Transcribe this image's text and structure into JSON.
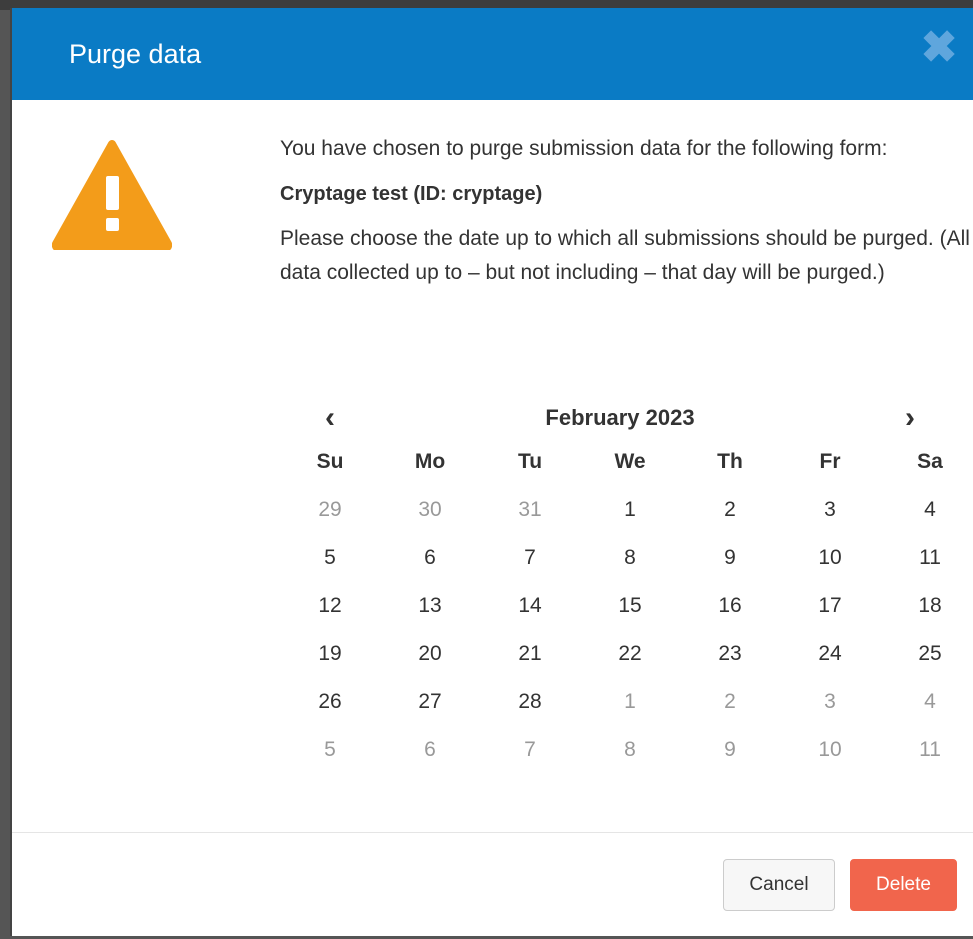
{
  "dialog": {
    "title": "Purge data",
    "close_icon": "close-icon"
  },
  "message": {
    "intro": "You have chosen to purge submission data for the following form:",
    "form_name": "Cryptage test (ID: cryptage)",
    "instructions": "Please choose the date up to which all submissions should be purged. (All data collected up to – but not including – that day will be purged.)"
  },
  "warning_icon": "warning-triangle-icon",
  "calendar": {
    "month_label": "February 2023",
    "prev_icon": "chevron-left-icon",
    "next_icon": "chevron-right-icon",
    "weekdays": [
      "Su",
      "Mo",
      "Tu",
      "We",
      "Th",
      "Fr",
      "Sa"
    ],
    "days": [
      [
        "29",
        "30",
        "31",
        "1",
        "2",
        "3",
        "4"
      ],
      [
        "5",
        "6",
        "7",
        "8",
        "9",
        "10",
        "11"
      ],
      [
        "12",
        "13",
        "14",
        "15",
        "16",
        "17",
        "18"
      ],
      [
        "19",
        "20",
        "21",
        "22",
        "23",
        "24",
        "25"
      ],
      [
        "26",
        "27",
        "28",
        "1",
        "2",
        "3",
        "4"
      ],
      [
        "5",
        "6",
        "7",
        "8",
        "9",
        "10",
        "11"
      ]
    ]
  },
  "buttons": {
    "cancel": "Cancel",
    "delete": "Delete"
  },
  "colors": {
    "header": "#0a7bc5",
    "warning": "#f39c1a",
    "delete": "#f1654c"
  }
}
